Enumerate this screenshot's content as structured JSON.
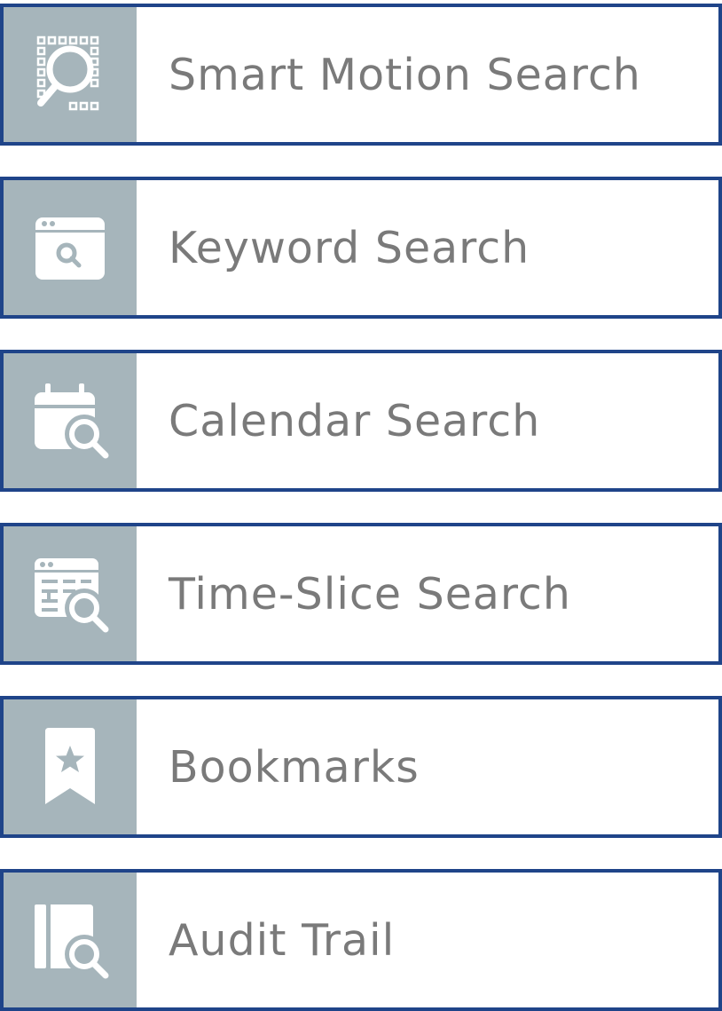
{
  "colors": {
    "border": "#1f4489",
    "icon_background": "#a6b5bb",
    "icon_foreground": "#ffffff",
    "label_text": "#7a7a7a"
  },
  "menu": {
    "items": [
      {
        "label": "Smart Motion Search",
        "icon": "smart-motion-search-icon"
      },
      {
        "label": "Keyword Search",
        "icon": "keyword-search-icon"
      },
      {
        "label": "Calendar Search",
        "icon": "calendar-search-icon"
      },
      {
        "label": "Time-Slice Search",
        "icon": "time-slice-search-icon"
      },
      {
        "label": "Bookmarks",
        "icon": "bookmark-star-icon"
      },
      {
        "label": "Audit Trail",
        "icon": "audit-trail-icon"
      }
    ]
  }
}
